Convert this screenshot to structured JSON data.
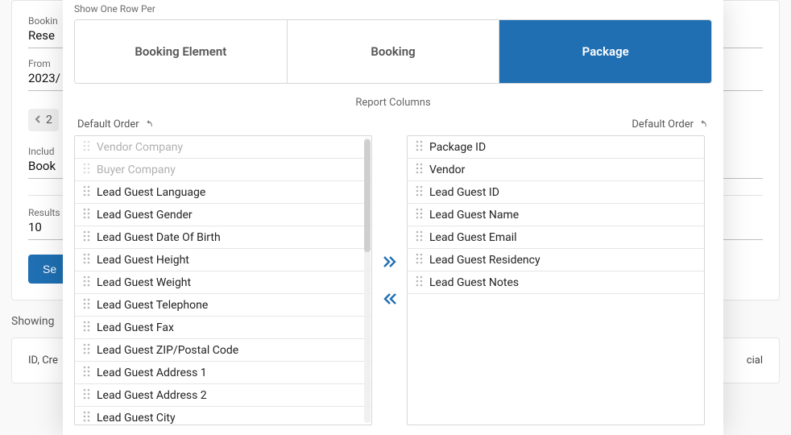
{
  "background": {
    "fields": {
      "booking_label": "Bookin",
      "booking_value": "Rese",
      "from_label": "From",
      "from_value": "2023/",
      "pager_value": "2",
      "include_label": "Includ",
      "include_value": "Book",
      "results_label": "Results",
      "results_value": "10",
      "search_button": "Se"
    },
    "showing_line": "Showing",
    "card": {
      "left": "ID, Cre",
      "right": "cial"
    }
  },
  "modal": {
    "show_row_label": "Show One Row Per",
    "tabs": [
      {
        "id": "booking-element",
        "label": "Booking Element",
        "active": false
      },
      {
        "id": "booking",
        "label": "Booking",
        "active": false
      },
      {
        "id": "package",
        "label": "Package",
        "active": true
      }
    ],
    "section_title": "Report Columns",
    "default_order_left": "Default Order",
    "default_order_right": "Default Order",
    "available_columns": [
      {
        "label": "Vendor Company",
        "muted": true
      },
      {
        "label": "Buyer Company",
        "muted": true
      },
      {
        "label": "Lead Guest Language",
        "muted": false
      },
      {
        "label": "Lead Guest Gender",
        "muted": false
      },
      {
        "label": "Lead Guest Date Of Birth",
        "muted": false
      },
      {
        "label": "Lead Guest Height",
        "muted": false
      },
      {
        "label": "Lead Guest Weight",
        "muted": false
      },
      {
        "label": "Lead Guest Telephone",
        "muted": false
      },
      {
        "label": "Lead Guest Fax",
        "muted": false
      },
      {
        "label": "Lead Guest ZIP/Postal Code",
        "muted": false
      },
      {
        "label": "Lead Guest Address 1",
        "muted": false
      },
      {
        "label": "Lead Guest Address 2",
        "muted": false
      },
      {
        "label": "Lead Guest City",
        "muted": false
      }
    ],
    "selected_columns": [
      {
        "label": "Package ID"
      },
      {
        "label": "Vendor"
      },
      {
        "label": "Lead Guest ID"
      },
      {
        "label": "Lead Guest Name"
      },
      {
        "label": "Lead Guest Email"
      },
      {
        "label": "Lead Guest Residency"
      },
      {
        "label": "Lead Guest Notes"
      }
    ]
  }
}
